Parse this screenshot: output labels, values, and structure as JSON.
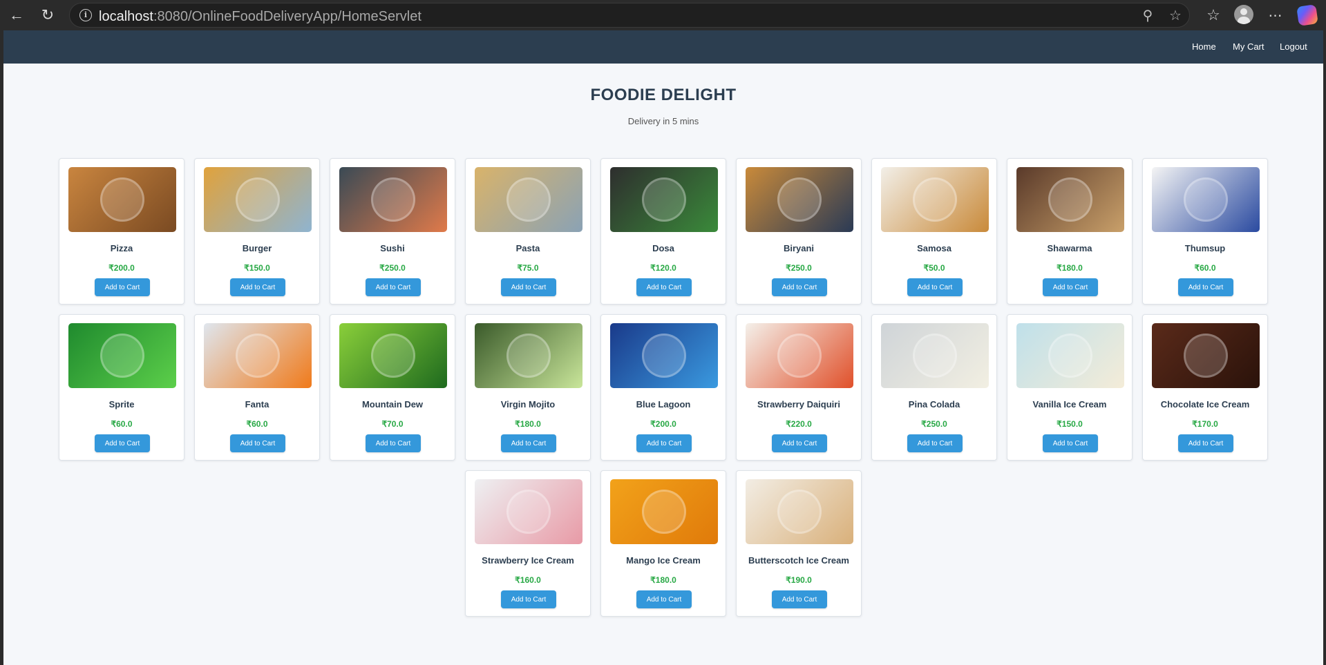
{
  "browser": {
    "url_host": "localhost",
    "url_path": ":8080/OnlineFoodDeliveryApp/HomeServlet"
  },
  "nav": {
    "links": [
      "Home",
      "My Cart",
      "Logout"
    ]
  },
  "header": {
    "title": "FOODIE DELIGHT",
    "subtitle": "Delivery in 5 mins"
  },
  "button_label": "Add to Cart",
  "items": [
    {
      "name": "Pizza",
      "price": "₹200.0",
      "colors": [
        "#c9853f",
        "#7a4a22"
      ]
    },
    {
      "name": "Burger",
      "price": "₹150.0",
      "colors": [
        "#e0a23c",
        "#8fb4d0"
      ]
    },
    {
      "name": "Sushi",
      "price": "₹250.0",
      "colors": [
        "#3a4a55",
        "#e07a4a"
      ]
    },
    {
      "name": "Pasta",
      "price": "₹75.0",
      "colors": [
        "#d9b36a",
        "#8aa2b5"
      ]
    },
    {
      "name": "Dosa",
      "price": "₹120.0",
      "colors": [
        "#2e2e2e",
        "#3a8a3a"
      ]
    },
    {
      "name": "Biryani",
      "price": "₹250.0",
      "colors": [
        "#c98a3a",
        "#2a3a55"
      ]
    },
    {
      "name": "Samosa",
      "price": "₹50.0",
      "colors": [
        "#f2efe8",
        "#c98a3a"
      ]
    },
    {
      "name": "Shawarma",
      "price": "₹180.0",
      "colors": [
        "#5a3a2a",
        "#c9a06a"
      ]
    },
    {
      "name": "Thumsup",
      "price": "₹60.0",
      "colors": [
        "#f4f4f4",
        "#2a4aa0"
      ]
    },
    {
      "name": "Sprite",
      "price": "₹60.0",
      "colors": [
        "#1f8a2e",
        "#5ccf4a"
      ]
    },
    {
      "name": "Fanta",
      "price": "₹60.0",
      "colors": [
        "#dfe6ee",
        "#f07a1a"
      ]
    },
    {
      "name": "Mountain Dew",
      "price": "₹70.0",
      "colors": [
        "#8acf3a",
        "#1e6a1e"
      ]
    },
    {
      "name": "Virgin Mojito",
      "price": "₹180.0",
      "colors": [
        "#3a5a2a",
        "#c9e69a"
      ]
    },
    {
      "name": "Blue Lagoon",
      "price": "₹200.0",
      "colors": [
        "#1a3a8a",
        "#3a9ae0"
      ]
    },
    {
      "name": "Strawberry Daiquiri",
      "price": "₹220.0",
      "colors": [
        "#f4f0ea",
        "#e0502a"
      ]
    },
    {
      "name": "Pina Colada",
      "price": "₹250.0",
      "colors": [
        "#cfd4d8",
        "#f2efe2"
      ]
    },
    {
      "name": "Vanilla Ice Cream",
      "price": "₹150.0",
      "colors": [
        "#bfe0ea",
        "#f4ecd8"
      ]
    },
    {
      "name": "Chocolate Ice Cream",
      "price": "₹170.0",
      "colors": [
        "#5a2a1a",
        "#2a120a"
      ]
    },
    {
      "name": "Strawberry Ice Cream",
      "price": "₹160.0",
      "colors": [
        "#eef0f2",
        "#e89aa6"
      ]
    },
    {
      "name": "Mango Ice Cream",
      "price": "₹180.0",
      "colors": [
        "#f2a21a",
        "#e07a0a"
      ]
    },
    {
      "name": "Butterscotch Ice Cream",
      "price": "₹190.0",
      "colors": [
        "#f2ede4",
        "#d9b07a"
      ]
    }
  ]
}
